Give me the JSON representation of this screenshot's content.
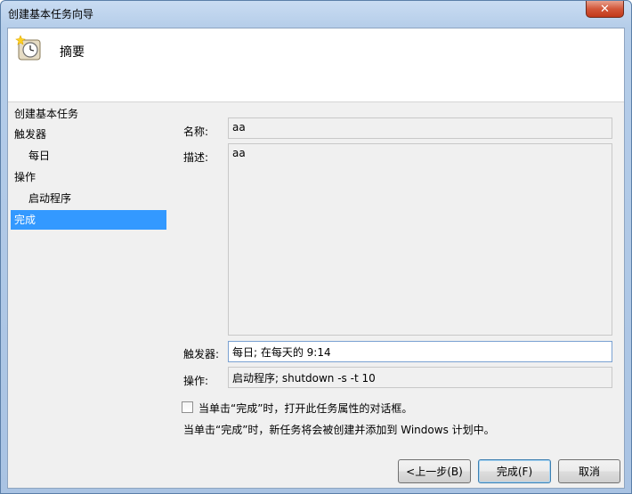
{
  "window": {
    "title": "创建基本任务向导",
    "close_glyph": "✕"
  },
  "header": {
    "title": "摘要",
    "icon": "clock-icon"
  },
  "nav": {
    "items": [
      {
        "label": "创建基本任务",
        "sub": false,
        "selected": false
      },
      {
        "label": "触发器",
        "sub": false,
        "selected": false
      },
      {
        "label": "每日",
        "sub": true,
        "selected": false
      },
      {
        "label": "操作",
        "sub": false,
        "selected": false
      },
      {
        "label": "启动程序",
        "sub": true,
        "selected": false
      },
      {
        "label": "完成",
        "sub": false,
        "selected": true
      }
    ]
  },
  "form": {
    "name_label": "名称:",
    "name_value": "aa",
    "desc_label": "描述:",
    "desc_value": "aa",
    "trigger_label": "触发器:",
    "trigger_value": "每日; 在每天的 9:14",
    "action_label": "操作:",
    "action_value": "启动程序; shutdown -s -t 10"
  },
  "options": {
    "open_properties_label": "当单击“完成”时，打开此任务属性的对话框。",
    "open_properties_checked": false,
    "info_text": "当单击“完成”时，新任务将会被创建并添加到 Windows 计划中。"
  },
  "buttons": {
    "back": "<上一步(B)",
    "finish": "完成(F)",
    "cancel": "取消"
  },
  "colors": {
    "selection": "#3399ff",
    "title_gradient": "#b5cde9"
  }
}
